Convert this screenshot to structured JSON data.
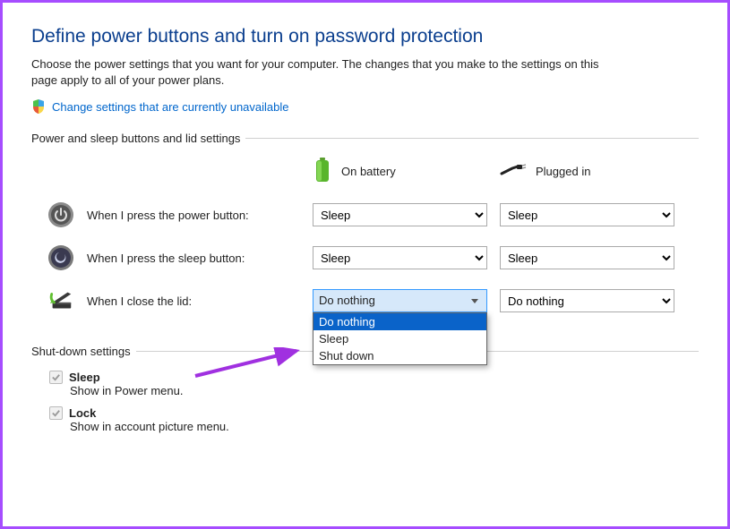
{
  "page_title": "Define power buttons and turn on password protection",
  "page_desc": "Choose the power settings that you want for your computer. The changes that you make to the settings on this page apply to all of your power plans.",
  "change_link": "Change settings that are currently unavailable",
  "section1_heading": "Power and sleep buttons and lid settings",
  "columns": {
    "battery": "On battery",
    "plugged": "Plugged in"
  },
  "rows": {
    "power_button": {
      "label": "When I press the power button:",
      "battery": "Sleep",
      "plugged": "Sleep"
    },
    "sleep_button": {
      "label": "When I press the sleep button:",
      "battery": "Sleep",
      "plugged": "Sleep"
    },
    "lid": {
      "label": "When I close the lid:",
      "battery": "Do nothing",
      "plugged": "Do nothing"
    }
  },
  "lid_dropdown_options": [
    "Do nothing",
    "Sleep",
    "Shut down"
  ],
  "section2_heading": "Shut-down settings",
  "shutdown": {
    "sleep": {
      "title": "Sleep",
      "sub": "Show in Power menu."
    },
    "lock": {
      "title": "Lock",
      "sub": "Show in account picture menu."
    }
  }
}
